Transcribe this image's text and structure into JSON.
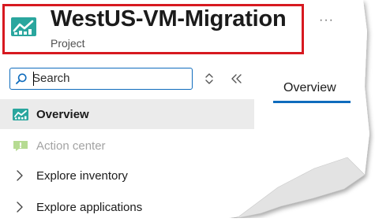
{
  "header": {
    "title": "WestUS-VM-Migration",
    "subtitle": "Project",
    "more_label": "···",
    "icon": "project-chart-icon"
  },
  "search": {
    "placeholder": "Search",
    "value": ""
  },
  "tabs": [
    {
      "label": "Overview",
      "selected": true
    }
  ],
  "nav": [
    {
      "label": "Overview",
      "icon": "chart-icon",
      "selected": true,
      "enabled": true
    },
    {
      "label": "Action center",
      "icon": "alert-icon",
      "selected": false,
      "enabled": false
    },
    {
      "label": "Explore inventory",
      "icon": "chevron-right-icon",
      "selected": false,
      "enabled": true
    },
    {
      "label": "Explore applications",
      "icon": "chevron-right-icon",
      "selected": false,
      "enabled": true
    }
  ],
  "colors": {
    "highlight": "#d71920",
    "accent": "#0f6cbd",
    "icon_teal": "#2aa69e",
    "disabled_text": "#a3a3a3",
    "selected_bg": "#ebebeb"
  }
}
